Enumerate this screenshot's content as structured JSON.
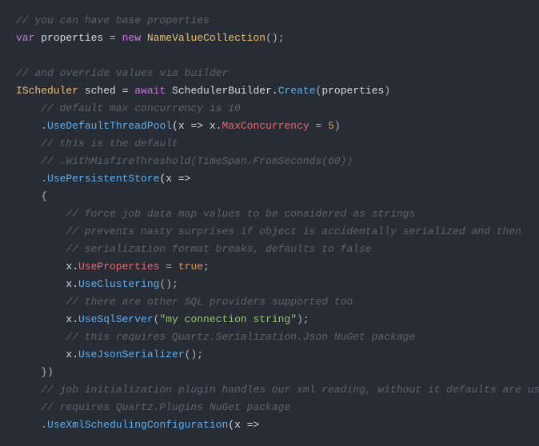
{
  "c": {
    "l1": "// you can have base properties",
    "l2_var": "var",
    "l2_prop": "properties",
    "l2_eq": " = ",
    "l2_new": "new",
    "l2_type": "NameValueCollection",
    "l2_tail": "();",
    "l3": "",
    "l4": "// and override values via builder",
    "l5_type": "IScheduler",
    "l5_var": " sched = ",
    "l5_await": "await",
    "l5_sb": " SchedulerBuilder.",
    "l5_create": "Create",
    "l5_open": "(",
    "l5_arg": "properties",
    "l5_close": ")",
    "l6": "    // default max concurrency is 10",
    "l7_pre": "    .",
    "l7_fn": "UseDefaultThreadPool",
    "l7_open": "(x => x.",
    "l7_prop": "MaxConcurrency",
    "l7_eq": " = ",
    "l7_num": "5",
    "l7_close": ")",
    "l8": "    // this is the default",
    "l9": "    // .WithMisfireThreshold(TimeSpan.FromSeconds(60))",
    "l10_pre": "    .",
    "l10_fn": "UsePersistentStore",
    "l10_tail": "(x =>",
    "l11": "    {",
    "l12": "        // force job data map values to be considered as strings",
    "l13": "        // prevents nasty surprises if object is accidentally serialized and then",
    "l14": "        // serialization format breaks, defaults to false",
    "l15_pre": "        x.",
    "l15_prop": "UseProperties",
    "l15_eq": " = ",
    "l15_val": "true",
    "l15_tail": ";",
    "l16_pre": "        x.",
    "l16_fn": "UseClustering",
    "l16_tail": "();",
    "l17": "        // there are other SQL providers supported too",
    "l18_pre": "        x.",
    "l18_fn": "UseSqlServer",
    "l18_open": "(",
    "l18_str": "\"my connection string\"",
    "l18_close": ");",
    "l19": "        // this requires Quartz.Serialization.Json NuGet package",
    "l20_pre": "        x.",
    "l20_fn": "UseJsonSerializer",
    "l20_tail": "();",
    "l21": "    })",
    "l22": "    // job initialization plugin handles our xml reading, without it defaults are used",
    "l23": "    // requires Quartz.Plugins NuGet package",
    "l24_pre": "    .",
    "l24_fn": "UseXmlSchedulingConfiguration",
    "l24_tail": "(x =>"
  }
}
